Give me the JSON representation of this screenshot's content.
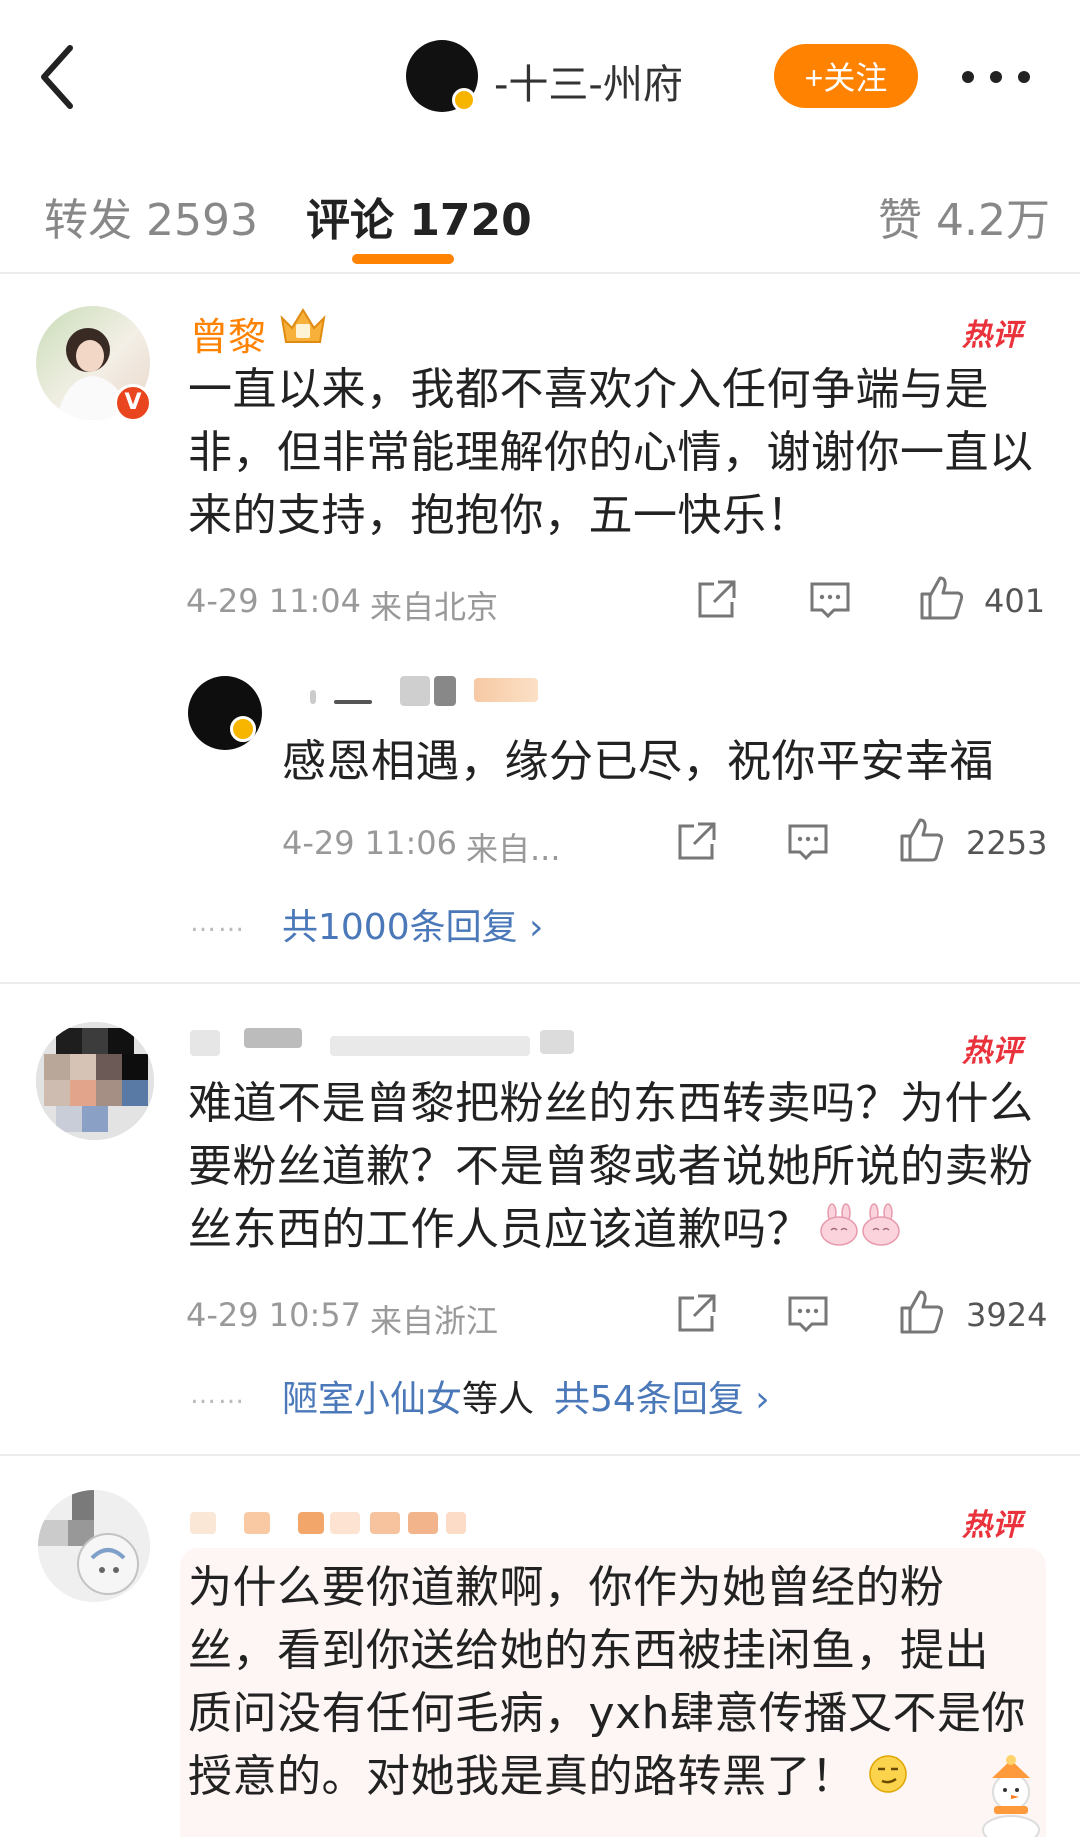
{
  "header": {
    "author": "-十三-州府",
    "follow_label": "+关注"
  },
  "tabs": {
    "repost": "转发 2593",
    "comments": "评论 1720",
    "likes": "赞 4.2万"
  },
  "comments": [
    {
      "username": "曾黎",
      "hot_badge": "热评",
      "lines": [
        "一直以来，我都不喜欢介入任何争端与是",
        "非，但非常能理解你的心情，谢谢你一直以",
        "来的支持，抱抱你，五一快乐！"
      ],
      "time": "4-29 11:04",
      "location": "来自北京",
      "likes": "401",
      "reply": {
        "text": "感恩相遇，缘分已尽，祝你平安幸福",
        "time": "4-29 11:06",
        "location": "来自...",
        "likes": "2253"
      },
      "more_dots": "……",
      "reply_count": "共1000条回复 ›"
    },
    {
      "hot_badge": "热评",
      "lines": [
        "难道不是曾黎把粉丝的东西转卖吗？为什么",
        "要粉丝道歉？不是曾黎或者说她所说的卖粉",
        "丝东西的工作人员应该道歉吗？"
      ],
      "time": "4-29 10:57",
      "location": "来自浙江",
      "likes": "3924",
      "more_dots": "……",
      "reply_user": "陋室小仙女",
      "reply_etc": "等人",
      "reply_count": "共54条回复 ›"
    },
    {
      "hot_badge": "热评",
      "lines": [
        "为什么要你道歉啊，你作为她曾经的粉",
        "丝，看到你送给她的东西被挂闲鱼，提出",
        "质问没有任何毛病，yxh肆意传播又不是你",
        "授意的。对她我是真的路转黑了！"
      ]
    }
  ],
  "colors": {
    "accent": "#ff8200",
    "link": "#4a78b8",
    "hot": "#e9323c"
  }
}
